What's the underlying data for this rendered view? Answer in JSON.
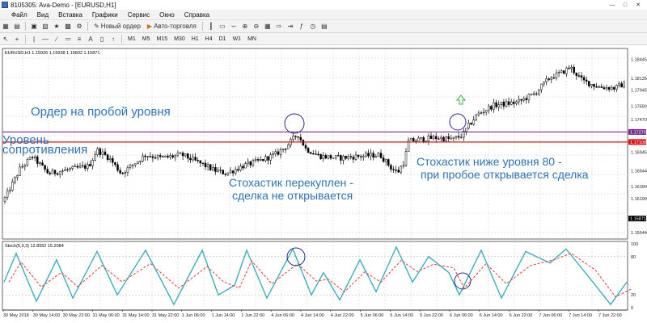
{
  "window": {
    "title": "8105305: Ava-Demo - [EURUSD,H1]"
  },
  "menu": [
    "Файл",
    "Вид",
    "Вставка",
    "Графики",
    "Сервис",
    "Окно",
    "Справка"
  ],
  "toolbar": {
    "new_order": "Новый ордер",
    "auto_trading": "Авто-торговля"
  },
  "timeframes": [
    "M1",
    "M5",
    "M15",
    "M30",
    "H1",
    "H4",
    "D1",
    "W1",
    "MN"
  ],
  "chart": {
    "info": "EURUSD,H1  1.15926 1.15938 1.15832 1.15871",
    "price_labels": [
      "1.18445",
      "1.18135",
      "1.17945",
      "1.17690",
      "1.17470",
      "1.17270",
      "1.17108",
      "1.16945",
      "1.16644",
      "1.16390",
      "1.16190",
      "1.15871",
      "1.15644"
    ],
    "order_level": "1.17270",
    "resistance_level": "1.17108",
    "current_price": "1.15871",
    "time_labels": [
      "30 May 2018",
      "30 May 14:00",
      "30 May 22:00",
      "31 May 06:00",
      "31 May 14:00",
      "31 May 22:00",
      "1 Jun 06:00",
      "1 Jun 14:00",
      "1 Jun 22:00",
      "4 Jun 06:00",
      "4 Jun 14:00",
      "4 Jun 22:00",
      "5 Jun 06:00",
      "5 Jun 14:00",
      "5 Jun 22:00",
      "6 Jun 06:00",
      "6 Jun 14:00",
      "6 Jun 22:00",
      "7 Jun 06:00",
      "7 Jun 14:00",
      "7 Jun 22:00"
    ],
    "colors": {
      "order_line": "#7a2a9a",
      "resistance_line": "#e01010",
      "candle": "#000000",
      "stoch_main": "#3aaec0",
      "stoch_signal": "#e23a3a",
      "annotation": "#2e73b8",
      "circle": "#2c2c8c",
      "up_arrow": "#3cb43c"
    }
  },
  "stochastic": {
    "label": "Stoch(5,3,3) 12.8552 15.2084",
    "levels": [
      "100",
      "80",
      "20",
      "0"
    ]
  },
  "annotations": {
    "order": "Ордер на пробой уровня",
    "resistance_1": "Уровень",
    "resistance_2": "сопротивления",
    "overbought_1": "Стохастик перекуплен -",
    "overbought_2": "сделка не открывается",
    "below80_1": "Стохастик ниже уровня 80 -",
    "below80_2": "при пробое открывается сделка"
  }
}
